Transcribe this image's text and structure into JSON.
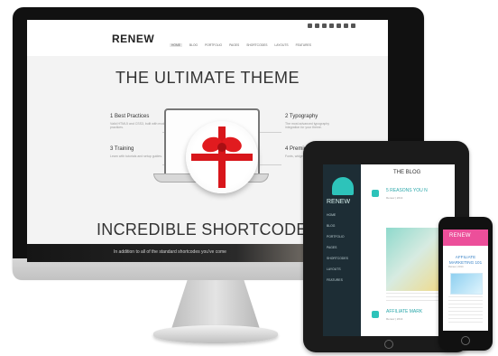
{
  "monitor": {
    "logo": "RENEW",
    "hero_title": "THE ULTIMATE THEME",
    "section_title": "INCREDIBLE SHORTCODES",
    "caption": "In addition to all of the standard shortcodes you've come",
    "nav": {
      "home": "HOME",
      "blog": "BLOG",
      "portfolio": "PORTFOLIO",
      "pages": "PAGES",
      "shortcodes": "SHORTCODES",
      "layouts": "LAYOUTS",
      "features": "FEATURES"
    },
    "features": [
      {
        "title": "1 Best Practices",
        "body": "Valid HTML5 and CSS3, built with modern practices."
      },
      {
        "title": "2 Typography",
        "body": "The most advanced typography integration for your theme."
      },
      {
        "title": "3 Training",
        "body": "Learn with tutorials and setup guides."
      },
      {
        "title": "4 Premium Goo",
        "body": "Fonts, widgets, and more."
      }
    ]
  },
  "tablet": {
    "logo": "RENEW",
    "content_title": "THE BLOG",
    "nav_items": [
      "HOME",
      "BLOG",
      "PORTFOLIO",
      "PAGES",
      "SHORTCODES",
      "LAYOUTS",
      "FEATURES"
    ],
    "posts": [
      {
        "title": "5 REASONS YOU N",
        "meta": "Renew | 2014"
      },
      {
        "title": "AFFILIATE MARK",
        "meta": "Renew | 2014"
      }
    ]
  },
  "phone": {
    "logo": "RENEW",
    "title": "AFFILIATE MARKETING 101",
    "meta": "Renew | 2014"
  },
  "colors": {
    "monitor_frame": "#111111",
    "teal": "#2dc3ba",
    "red": "#d8161b",
    "pink": "#ec4f9a"
  }
}
